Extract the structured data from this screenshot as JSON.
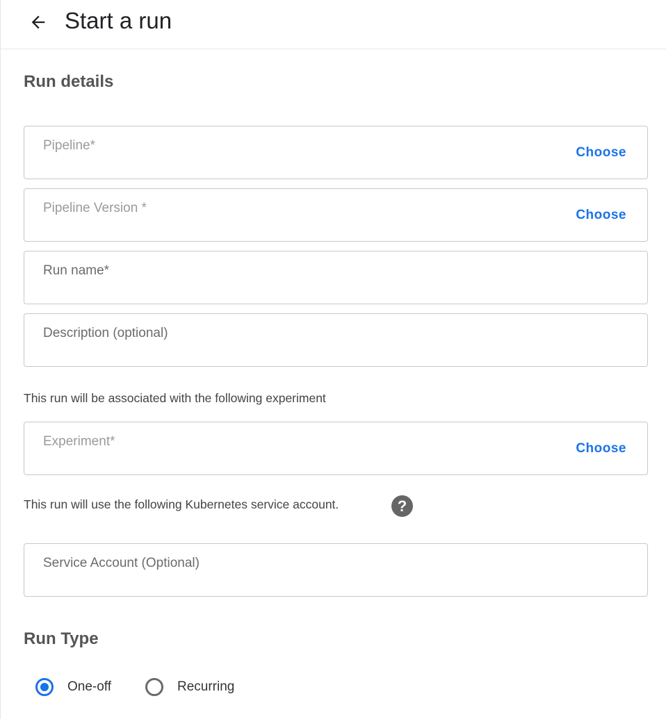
{
  "header": {
    "title": "Start a run",
    "back_icon": "arrow-back-icon"
  },
  "run_details": {
    "title": "Run details",
    "pipeline": {
      "label": "Pipeline",
      "required": "*",
      "action": "Choose"
    },
    "pipeline_version": {
      "label": "Pipeline Version",
      "required": "*",
      "action": "Choose"
    },
    "run_name": {
      "label": "Run name",
      "required": "*"
    },
    "description": {
      "label": "Description (optional)"
    }
  },
  "experiment": {
    "helper": "This run will be associated with the following experiment",
    "field": {
      "label": "Experiment",
      "required": "*",
      "action": "Choose"
    }
  },
  "service_account": {
    "helper": "This run will use the following Kubernetes service account.",
    "help_glyph": "?",
    "field": {
      "label": "Service Account (Optional)"
    }
  },
  "run_type": {
    "title": "Run Type",
    "options": [
      {
        "label": "One-off",
        "selected": true
      },
      {
        "label": "Recurring",
        "selected": false
      }
    ]
  },
  "colors": {
    "accent": "#1a73e8",
    "field_border": "#c8c8c8",
    "placeholder": "#9a9a9a",
    "section_title": "#555555"
  }
}
